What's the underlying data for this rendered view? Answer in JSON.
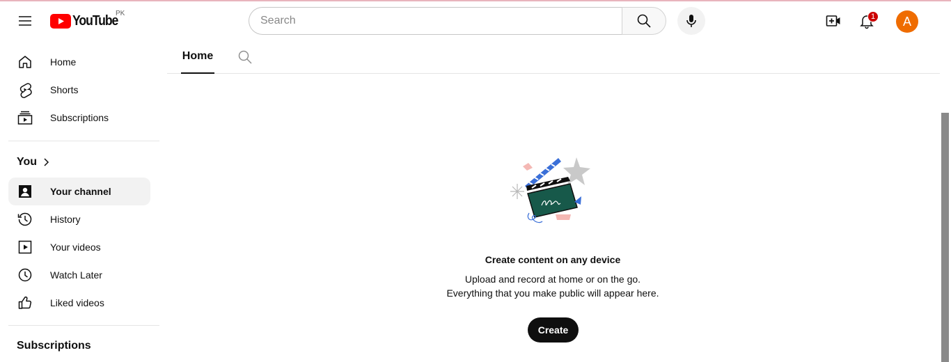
{
  "masthead": {
    "logo_text": "YouTube",
    "country_code": "PK",
    "search_placeholder": "Search",
    "notification_count": "1",
    "avatar_letter": "A",
    "brand_red": "#ff0000",
    "avatar_color": "#ef6c00"
  },
  "sidebar": {
    "main_items": [
      {
        "label": "Home",
        "icon": "home-icon"
      },
      {
        "label": "Shorts",
        "icon": "shorts-icon"
      },
      {
        "label": "Subscriptions",
        "icon": "subscriptions-icon"
      }
    ],
    "you_section": {
      "title": "You",
      "items": [
        {
          "label": "Your channel",
          "icon": "your-channel-icon",
          "active": true
        },
        {
          "label": "History",
          "icon": "history-icon"
        },
        {
          "label": "Your videos",
          "icon": "your-videos-icon"
        },
        {
          "label": "Watch Later",
          "icon": "watch-later-icon"
        },
        {
          "label": "Liked videos",
          "icon": "liked-videos-icon"
        }
      ]
    },
    "subscriptions_section": {
      "title": "Subscriptions"
    }
  },
  "channel_tabs": {
    "active_tab": "Home"
  },
  "empty_state": {
    "title": "Create content on any device",
    "line1": "Upload and record at home or on the go.",
    "line2": "Everything that you make public will appear here.",
    "button_label": "Create"
  }
}
